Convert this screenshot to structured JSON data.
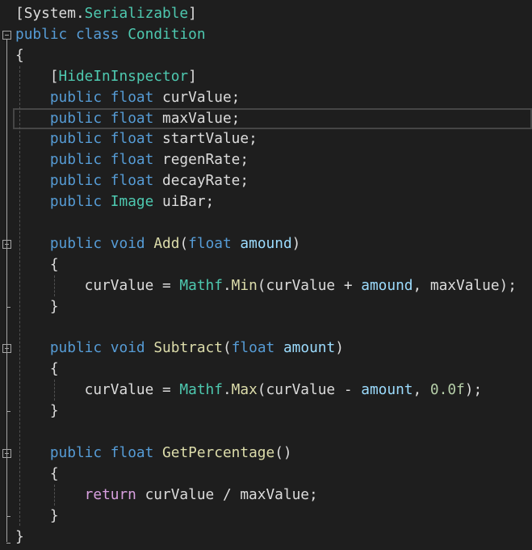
{
  "lines": [
    [
      {
        "t": "[",
        "c": "pl"
      },
      {
        "t": "System",
        "c": "pl"
      },
      {
        "t": ".",
        "c": "pl"
      },
      {
        "t": "Serializable",
        "c": "ty"
      },
      {
        "t": "]",
        "c": "pl"
      }
    ],
    [
      {
        "t": "public",
        "c": "kw"
      },
      {
        "t": " ",
        "c": "pl"
      },
      {
        "t": "class",
        "c": "kw"
      },
      {
        "t": " ",
        "c": "pl"
      },
      {
        "t": "Condition",
        "c": "ty"
      }
    ],
    [
      {
        "t": "{",
        "c": "pl"
      }
    ],
    [
      {
        "t": "    [",
        "c": "pl"
      },
      {
        "t": "HideInInspector",
        "c": "ty"
      },
      {
        "t": "]",
        "c": "pl"
      }
    ],
    [
      {
        "t": "    ",
        "c": "pl"
      },
      {
        "t": "public",
        "c": "kw"
      },
      {
        "t": " ",
        "c": "pl"
      },
      {
        "t": "float",
        "c": "kw"
      },
      {
        "t": " curValue;",
        "c": "pl"
      }
    ],
    [
      {
        "t": "    ",
        "c": "pl"
      },
      {
        "t": "public",
        "c": "kw"
      },
      {
        "t": " ",
        "c": "pl"
      },
      {
        "t": "float",
        "c": "kw"
      },
      {
        "t": " maxValue;",
        "c": "pl"
      }
    ],
    [
      {
        "t": "    ",
        "c": "pl"
      },
      {
        "t": "public",
        "c": "kw"
      },
      {
        "t": " ",
        "c": "pl"
      },
      {
        "t": "float",
        "c": "kw"
      },
      {
        "t": " startValue;",
        "c": "pl"
      }
    ],
    [
      {
        "t": "    ",
        "c": "pl"
      },
      {
        "t": "public",
        "c": "kw"
      },
      {
        "t": " ",
        "c": "pl"
      },
      {
        "t": "float",
        "c": "kw"
      },
      {
        "t": " regenRate;",
        "c": "pl"
      }
    ],
    [
      {
        "t": "    ",
        "c": "pl"
      },
      {
        "t": "public",
        "c": "kw"
      },
      {
        "t": " ",
        "c": "pl"
      },
      {
        "t": "float",
        "c": "kw"
      },
      {
        "t": " decayRate;",
        "c": "pl"
      }
    ],
    [
      {
        "t": "    ",
        "c": "pl"
      },
      {
        "t": "public",
        "c": "kw"
      },
      {
        "t": " ",
        "c": "pl"
      },
      {
        "t": "Image",
        "c": "ty"
      },
      {
        "t": " uiBar;",
        "c": "pl"
      }
    ],
    [],
    [
      {
        "t": "    ",
        "c": "pl"
      },
      {
        "t": "public",
        "c": "kw"
      },
      {
        "t": " ",
        "c": "pl"
      },
      {
        "t": "void",
        "c": "kw"
      },
      {
        "t": " ",
        "c": "pl"
      },
      {
        "t": "Add",
        "c": "fn"
      },
      {
        "t": "(",
        "c": "pl"
      },
      {
        "t": "float",
        "c": "kw"
      },
      {
        "t": " ",
        "c": "pl"
      },
      {
        "t": "amound",
        "c": "pr"
      },
      {
        "t": ")",
        "c": "pl"
      }
    ],
    [
      {
        "t": "    {",
        "c": "pl"
      }
    ],
    [
      {
        "t": "        curValue = ",
        "c": "pl"
      },
      {
        "t": "Mathf",
        "c": "ty"
      },
      {
        "t": ".",
        "c": "pl"
      },
      {
        "t": "Min",
        "c": "fn"
      },
      {
        "t": "(curValue + ",
        "c": "pl"
      },
      {
        "t": "amound",
        "c": "pr"
      },
      {
        "t": ", maxValue);",
        "c": "pl"
      }
    ],
    [
      {
        "t": "    }",
        "c": "pl"
      }
    ],
    [],
    [
      {
        "t": "    ",
        "c": "pl"
      },
      {
        "t": "public",
        "c": "kw"
      },
      {
        "t": " ",
        "c": "pl"
      },
      {
        "t": "void",
        "c": "kw"
      },
      {
        "t": " ",
        "c": "pl"
      },
      {
        "t": "Subtract",
        "c": "fn"
      },
      {
        "t": "(",
        "c": "pl"
      },
      {
        "t": "float",
        "c": "kw"
      },
      {
        "t": " ",
        "c": "pl"
      },
      {
        "t": "amount",
        "c": "pr"
      },
      {
        "t": ")",
        "c": "pl"
      }
    ],
    [
      {
        "t": "    {",
        "c": "pl"
      }
    ],
    [
      {
        "t": "        curValue = ",
        "c": "pl"
      },
      {
        "t": "Mathf",
        "c": "ty"
      },
      {
        "t": ".",
        "c": "pl"
      },
      {
        "t": "Max",
        "c": "fn"
      },
      {
        "t": "(curValue - ",
        "c": "pl"
      },
      {
        "t": "amount",
        "c": "pr"
      },
      {
        "t": ", ",
        "c": "pl"
      },
      {
        "t": "0.0f",
        "c": "nu"
      },
      {
        "t": ");",
        "c": "pl"
      }
    ],
    [
      {
        "t": "    }",
        "c": "pl"
      }
    ],
    [],
    [
      {
        "t": "    ",
        "c": "pl"
      },
      {
        "t": "public",
        "c": "kw"
      },
      {
        "t": " ",
        "c": "pl"
      },
      {
        "t": "float",
        "c": "kw"
      },
      {
        "t": " ",
        "c": "pl"
      },
      {
        "t": "GetPercentage",
        "c": "fn"
      },
      {
        "t": "()",
        "c": "pl"
      }
    ],
    [
      {
        "t": "    {",
        "c": "pl"
      }
    ],
    [
      {
        "t": "        ",
        "c": "pl"
      },
      {
        "t": "return",
        "c": "ct"
      },
      {
        "t": " curValue / maxValue;",
        "c": "pl"
      }
    ],
    [
      {
        "t": "    }",
        "c": "pl"
      }
    ],
    [
      {
        "t": "}",
        "c": "pl"
      }
    ]
  ],
  "current_line": 5,
  "fold_markers": [
    1,
    11,
    16,
    21
  ],
  "colors": {
    "background": "#1e1e1e",
    "keyword": "#569cd6",
    "type": "#4ec9b0",
    "method": "#dcdcaa",
    "parameter": "#9cdcfe",
    "number": "#b5cea8",
    "control": "#d8a0df",
    "text": "#dcdcdc"
  }
}
